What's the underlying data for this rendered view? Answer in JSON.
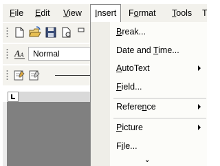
{
  "menubar": {
    "items": [
      {
        "label": "File"
      },
      {
        "label": "Edit"
      },
      {
        "label": "View"
      },
      {
        "label": "Insert"
      },
      {
        "label": "Format"
      },
      {
        "label": "Tools"
      },
      {
        "label": "T"
      }
    ]
  },
  "formatting_toolbar": {
    "style_value": "Normal"
  },
  "insert_menu": {
    "items": [
      {
        "label": "Break..."
      },
      {
        "label": "Date and Time..."
      },
      {
        "label": "AutoText",
        "submenu": true
      },
      {
        "label": "Field..."
      },
      {
        "label": "Reference",
        "submenu": true
      },
      {
        "label": "Picture",
        "submenu": true
      },
      {
        "label": "File..."
      }
    ],
    "expand_glyph": "⌄"
  },
  "icons": [
    "new-document-icon",
    "open-folder-icon",
    "save-icon",
    "permission-icon",
    "styles-icon",
    "form-icon",
    "edit-form-icon",
    "expand-chevron-icon"
  ]
}
